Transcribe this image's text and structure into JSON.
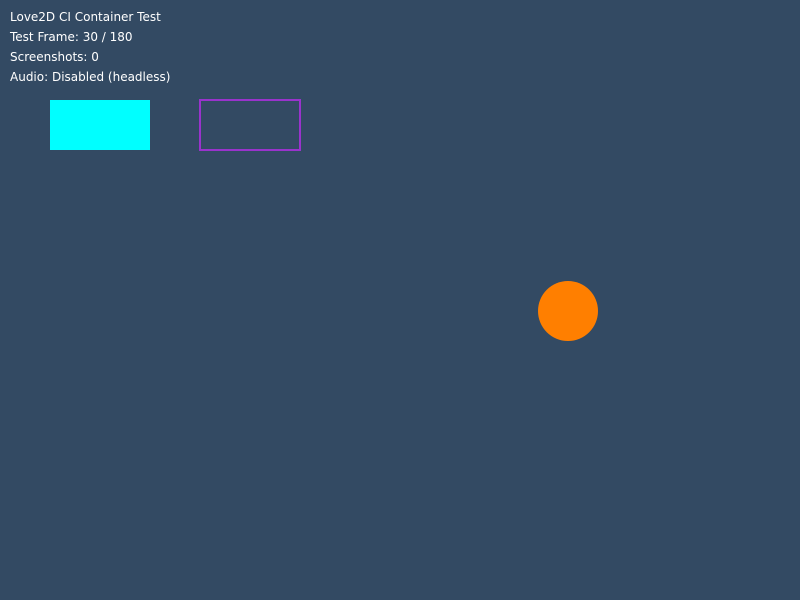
{
  "hud": {
    "title": "Love2D CI Container Test",
    "frame_text": "Test Frame: 30 / 180",
    "screenshots_text": "Screenshots: 0",
    "audio_text": "Audio: Disabled (headless)"
  },
  "test_state": {
    "current_frame": 30,
    "total_frames": 180,
    "screenshots": 0,
    "audio": "Disabled (headless)"
  },
  "colors": {
    "background": "#334a63",
    "text": "#ffffff",
    "filled_rectangle": "#00ffff",
    "outline_rectangle": "#9933cc",
    "circle": "#ff7f00"
  },
  "shapes": [
    {
      "kind": "filled-rectangle",
      "color": "cyan"
    },
    {
      "kind": "outline-rectangle",
      "color": "purple"
    },
    {
      "kind": "circle",
      "color": "orange"
    }
  ]
}
